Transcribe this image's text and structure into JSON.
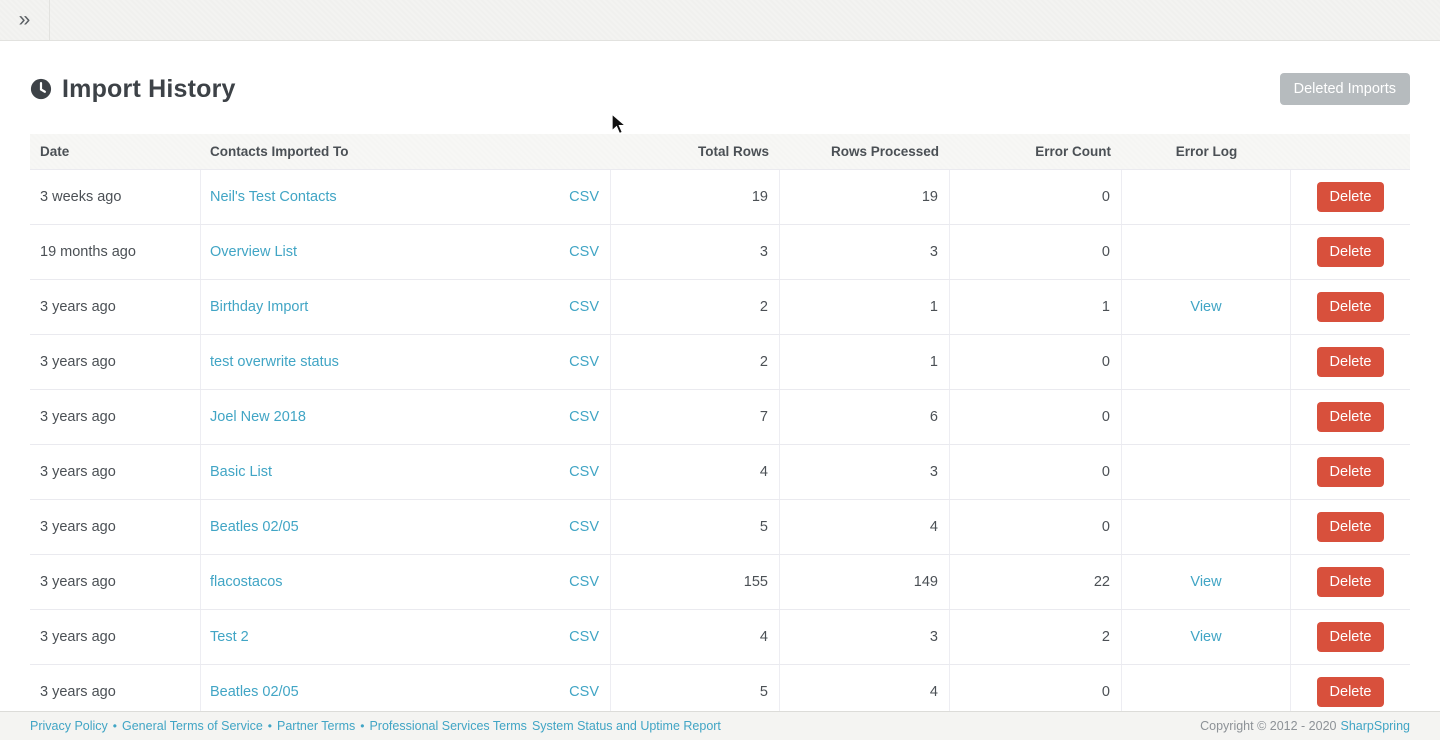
{
  "topbar": {
    "expand_icon": "»"
  },
  "page": {
    "title": "Import History",
    "deleted_imports_button": "Deleted Imports"
  },
  "table": {
    "headers": [
      "Date",
      "Contacts Imported To",
      "Total Rows",
      "Rows Processed",
      "Error Count",
      "Error Log"
    ],
    "csv_label": "CSV",
    "view_label": "View",
    "delete_label": "Delete",
    "rows": [
      {
        "date": "3 weeks ago",
        "list": "Neil's Test Contacts",
        "total": "19",
        "processed": "19",
        "errors": "0",
        "error_log": ""
      },
      {
        "date": "19 months ago",
        "list": "Overview List",
        "total": "3",
        "processed": "3",
        "errors": "0",
        "error_log": ""
      },
      {
        "date": "3 years ago",
        "list": "Birthday Import",
        "total": "2",
        "processed": "1",
        "errors": "1",
        "error_log": "View"
      },
      {
        "date": "3 years ago",
        "list": "test overwrite status",
        "total": "2",
        "processed": "1",
        "errors": "0",
        "error_log": ""
      },
      {
        "date": "3 years ago",
        "list": "Joel New 2018",
        "total": "7",
        "processed": "6",
        "errors": "0",
        "error_log": ""
      },
      {
        "date": "3 years ago",
        "list": "Basic List",
        "total": "4",
        "processed": "3",
        "errors": "0",
        "error_log": ""
      },
      {
        "date": "3 years ago",
        "list": "Beatles 02/05",
        "total": "5",
        "processed": "4",
        "errors": "0",
        "error_log": ""
      },
      {
        "date": "3 years ago",
        "list": "flacostacos",
        "total": "155",
        "processed": "149",
        "errors": "22",
        "error_log": "View"
      },
      {
        "date": "3 years ago",
        "list": "Test 2",
        "total": "4",
        "processed": "3",
        "errors": "2",
        "error_log": "View"
      },
      {
        "date": "3 years ago",
        "list": "Beatles 02/05",
        "total": "5",
        "processed": "4",
        "errors": "0",
        "error_log": ""
      }
    ]
  },
  "footer": {
    "links": [
      "Privacy Policy",
      "General Terms of Service",
      "Partner Terms",
      "Professional Services Terms",
      "System Status and Uptime Report"
    ],
    "separator": "•",
    "bullets_after_first_n_links": 3,
    "copyright": "Copyright © 2012 - 2020",
    "brand": "SharpSpring"
  },
  "colors": {
    "link_teal": "#41a5c5",
    "delete_red": "#d8503c",
    "deleted_imports_gray": "#b6bbbe",
    "title_dark": "#3d4247",
    "topbar_bg": "#f3f3f1",
    "header_row_bg": "#f7f7f5",
    "footer_bg": "#f4f4f2"
  }
}
